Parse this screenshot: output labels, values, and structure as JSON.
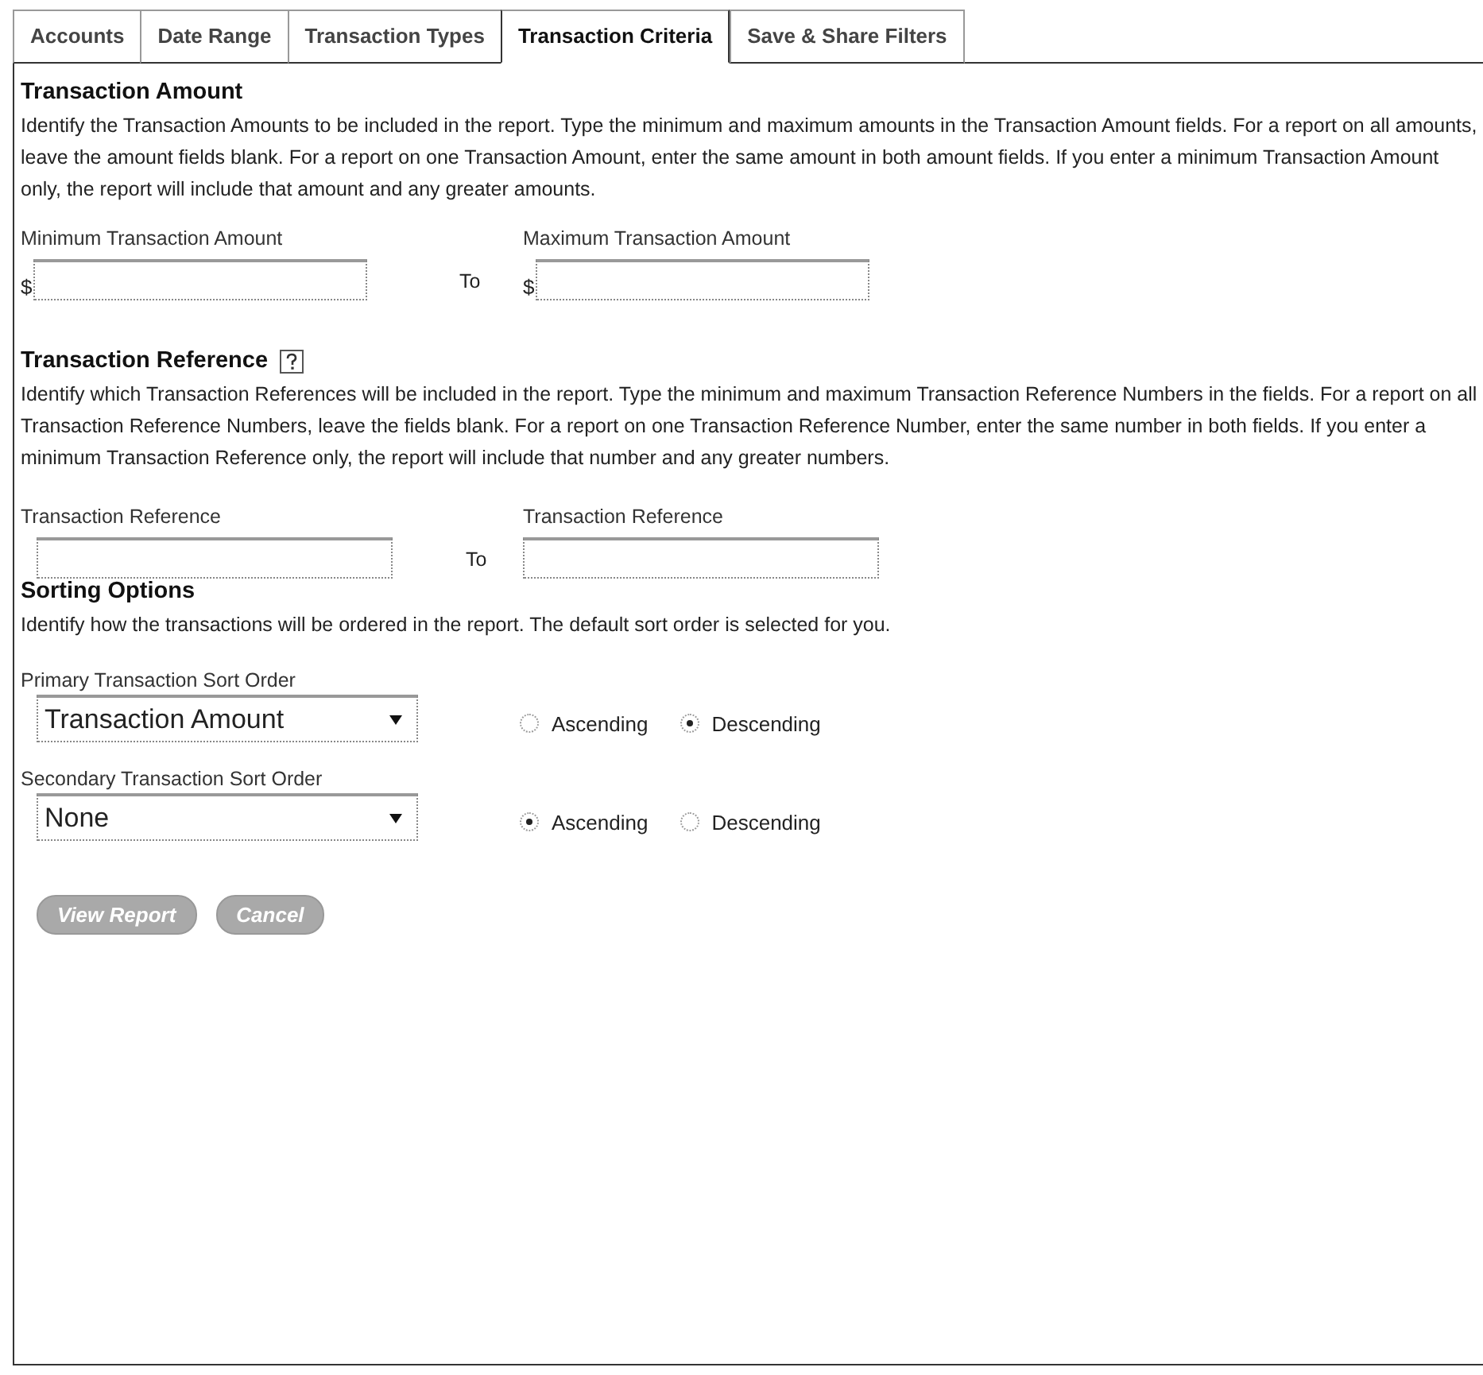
{
  "tabs": [
    {
      "label": "Accounts",
      "selected": false
    },
    {
      "label": "Date Range",
      "selected": false
    },
    {
      "label": "Transaction Types",
      "selected": false
    },
    {
      "label": "Transaction Criteria",
      "selected": true
    },
    {
      "label": "Save & Share Filters",
      "selected": false
    }
  ],
  "transaction_amount": {
    "title": "Transaction Amount",
    "description": "Identify the Transaction Amounts to be included in the report. Type the minimum and maximum amounts in the Transaction Amount fields. For a report on all amounts, leave the amount fields blank. For a report on one Transaction Amount, enter the same amount in both amount fields. If you enter a minimum Transaction Amount only, the report will include that amount and any greater amounts.",
    "fields": [
      {
        "label": "Minimum Transaction Amount",
        "prefix": "$"
      },
      {
        "label": "Maximum Transaction Amount",
        "prefix": "$"
      }
    ],
    "separator": "To"
  },
  "transaction_reference": {
    "title": "Transaction Reference",
    "description": "Identify which Transaction References will be included in the report. Type the minimum and maximum Transaction Reference Numbers in the fields. For a report on all Transaction Reference Numbers, leave the fields blank. For a report on one Transaction Reference Number, enter the same number in both fields. If you enter a minimum Transaction Reference only, the report will include that number and any greater numbers.",
    "fields": [
      {
        "label": "Transaction Reference"
      },
      {
        "label": "Transaction Reference"
      }
    ],
    "separator": "To"
  },
  "sorting_options": {
    "title": "Sorting Options",
    "description": "Identify how the transactions will be ordered in the report. The default sort order is selected for you.",
    "sort_orders": [
      {
        "label": "Primary Transaction Sort Order",
        "value": "Transaction Amount",
        "directions": [
          {
            "label": "Ascending",
            "selected": false
          },
          {
            "label": "Descending",
            "selected": true
          }
        ]
      },
      {
        "label": "Secondary Transaction Sort Order",
        "value": "None",
        "directions": [
          {
            "label": "Ascending",
            "selected": true
          },
          {
            "label": "Descending",
            "selected": false
          }
        ]
      }
    ]
  },
  "buttons": [
    "View Report",
    "Cancel"
  ]
}
